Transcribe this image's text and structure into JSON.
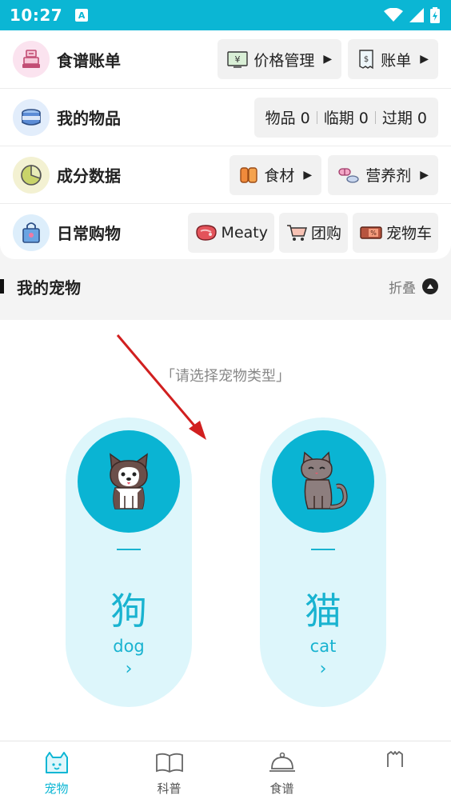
{
  "status": {
    "time": "10:27",
    "badge": "A"
  },
  "rows": [
    {
      "label": "食谱账单",
      "actions": [
        {
          "label": "价格管理"
        },
        {
          "label": "账单"
        }
      ]
    },
    {
      "label": "我的物品",
      "stats": [
        "物品 0",
        "临期 0",
        "过期 0"
      ]
    },
    {
      "label": "成分数据",
      "actions": [
        {
          "label": "食材"
        },
        {
          "label": "营养剂"
        }
      ]
    },
    {
      "label": "日常购物",
      "actions": [
        {
          "label": "Meaty"
        },
        {
          "label": "团购"
        },
        {
          "label": "宠物车"
        }
      ]
    }
  ],
  "section": {
    "title": "我的宠物",
    "collapse_label": "折叠"
  },
  "pets": {
    "prompt": "「请选择宠物类型」",
    "dog": {
      "zh": "狗",
      "en": "dog",
      "arrow": "›"
    },
    "cat": {
      "zh": "猫",
      "en": "cat",
      "arrow": "›"
    }
  },
  "tabs": [
    {
      "label": "宠物",
      "active": true
    },
    {
      "label": "科普"
    },
    {
      "label": "食谱"
    },
    {
      "label": ""
    }
  ],
  "colors": {
    "accent": "#0bb6d4",
    "pet_bg": "#ddf6fb",
    "arrow": "#d11f1f"
  }
}
